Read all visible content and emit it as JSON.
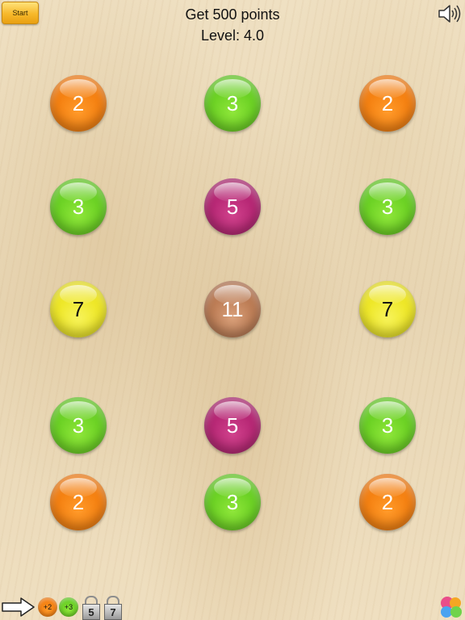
{
  "header": {
    "start_label": "Start",
    "goal_text": "Get 500 points",
    "level_text": "Level: 4.0"
  },
  "balls": [
    {
      "value": "2",
      "color": "orange"
    },
    {
      "value": "3",
      "color": "green"
    },
    {
      "value": "2",
      "color": "orange"
    },
    {
      "value": "3",
      "color": "green"
    },
    {
      "value": "5",
      "color": "magenta"
    },
    {
      "value": "3",
      "color": "green"
    },
    {
      "value": "7",
      "color": "yellow"
    },
    {
      "value": "11",
      "color": "copper"
    },
    {
      "value": "7",
      "color": "yellow"
    },
    {
      "value": "3",
      "color": "green"
    },
    {
      "value": "5",
      "color": "magenta"
    },
    {
      "value": "3",
      "color": "green"
    },
    {
      "value": "2",
      "color": "orange"
    },
    {
      "value": "3",
      "color": "green"
    },
    {
      "value": "2",
      "color": "orange"
    }
  ],
  "toolbar": {
    "arrow_icon": "right-arrow-icon",
    "plus2_label": "+2",
    "plus3_label": "+3",
    "lock5_label": "5",
    "lock7_label": "7",
    "gamecenter_icon": "game-center-icon",
    "sound_icon": "speaker-icon"
  },
  "colors": {
    "orange": "#f27a0a",
    "green": "#62cc1e",
    "magenta": "#b0206e",
    "yellow": "#ece41a",
    "copper": "#b5734b",
    "start_button": "#f7b82a"
  }
}
